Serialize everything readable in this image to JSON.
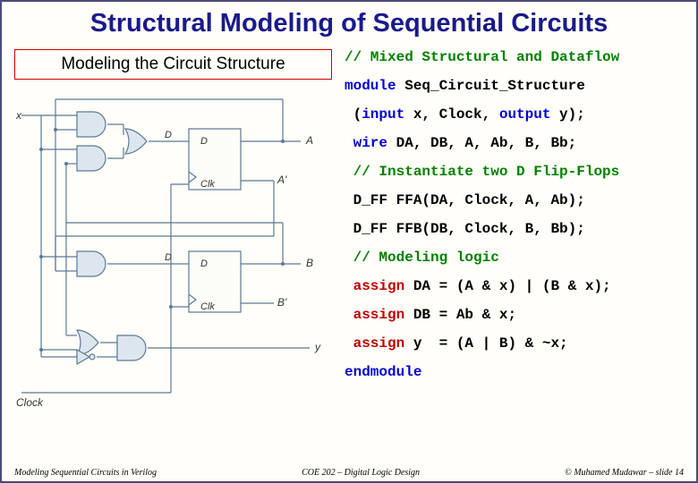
{
  "title": "Structural Modeling of Sequential Circuits",
  "subtitle": "Modeling the Circuit Structure",
  "code": {
    "l1_comment": "// Mixed Structural and Dataflow",
    "l2_module": "module",
    "l2_name": " Seq_Circuit_Structure",
    "l3_open": " (",
    "l3_input": "input",
    "l3_args1": " x, Clock, ",
    "l3_output": "output",
    "l3_args2": " y);",
    "l4_wire": " wire",
    "l4_vars": " DA, DB, A, Ab, B, Bb;",
    "l5_comment": " // Instantiate two D Flip-Flops",
    "l6": " D_FF FFA(DA, Clock, A, Ab);",
    "l7": " D_FF FFB(DB, Clock, B, Bb);",
    "l8_comment": " // Modeling logic",
    "l9_assign": " assign",
    "l9_rest": " DA = (A & x) | (B & x);",
    "l10_assign": " assign",
    "l10_rest": " DB = Ab & x;",
    "l11_assign": " assign",
    "l11_rest": " y  = (A | B) & ~x;",
    "l12_end": "endmodule"
  },
  "diagram_labels": {
    "x": "x",
    "D1": "D",
    "Clk1": "Clk",
    "A": "A",
    "Ab": "A'",
    "D2": "D",
    "Clk2": "Clk",
    "B": "B",
    "Bb": "B'",
    "Clock": "Clock",
    "y": "y"
  },
  "footer": {
    "left": "Modeling Sequential Circuits in Verilog",
    "center": "COE 202 – Digital Logic Design",
    "right": "© Muhamed Mudawar – slide 14"
  }
}
